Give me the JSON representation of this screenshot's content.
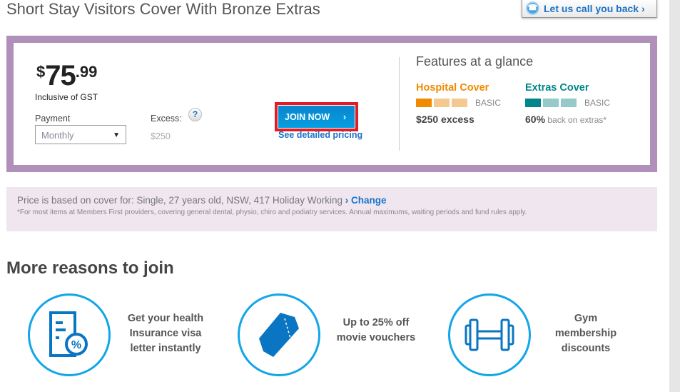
{
  "header": {
    "title": "Short Stay Visitors Cover With Bronze Extras",
    "callback_label": "Let us call you back",
    "callback_chevron": "›"
  },
  "price": {
    "currency": "$",
    "whole": "75",
    "cents": ".99",
    "note": "Inclusive of GST"
  },
  "payment": {
    "label": "Payment",
    "selected": "Monthly"
  },
  "excess": {
    "label": "Excess:",
    "help": "?",
    "value": "$250"
  },
  "actions": {
    "join_label": "JOIN NOW",
    "join_chevron": "›",
    "detail_link": "See detailed pricing"
  },
  "features": {
    "title": "Features at a glance",
    "hospital": {
      "title": "Hospital Cover",
      "level": "BASIC",
      "level_fill": 1,
      "level_max": 3,
      "summary_bold": "$250 excess",
      "summary_rest": "",
      "color": "#f08a00",
      "light": "#f3c98f"
    },
    "extras": {
      "title": "Extras Cover",
      "level": "BASIC",
      "level_fill": 1,
      "level_max": 3,
      "summary_bold": "60%",
      "summary_rest": " back on extras*",
      "color": "#00868a",
      "light": "#96c9ca"
    }
  },
  "info": {
    "based_on": "Price is based on cover for: Single, 27 years old, NSW, 417 Holiday Working ",
    "change_label": "› Change",
    "footnote": "*For most items at Members First providers, covering general dental, physio, chiro and podiatry services. Annual maximums, waiting periods and fund rules apply."
  },
  "reasons": {
    "title": "More reasons to join",
    "items": [
      {
        "icon": "document-percent-icon",
        "lines": [
          "Get your health",
          "Insurance visa",
          "letter instantly"
        ]
      },
      {
        "icon": "ticket-icon",
        "lines": [
          "Up to 25% off",
          "movie vouchers"
        ]
      },
      {
        "icon": "dumbbell-icon",
        "lines": [
          "Gym",
          "membership",
          "discounts"
        ]
      }
    ]
  }
}
